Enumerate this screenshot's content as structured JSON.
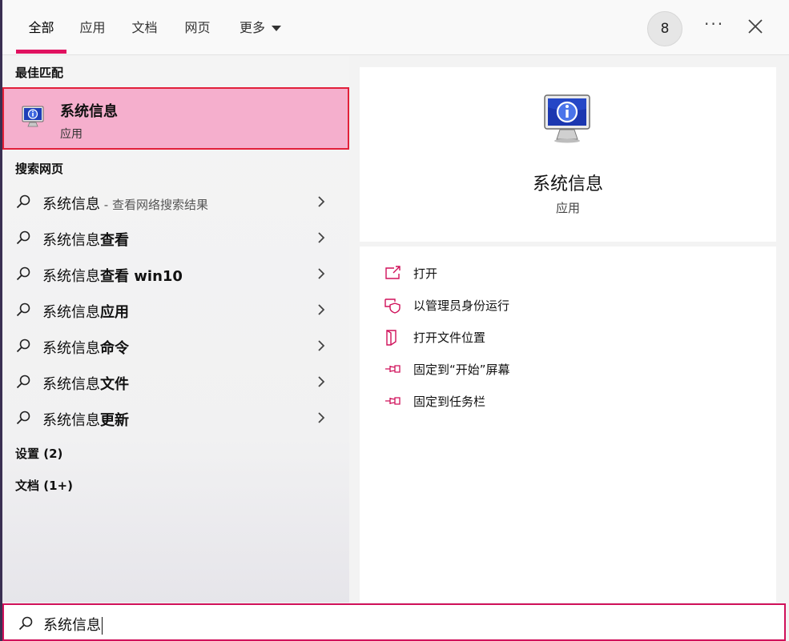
{
  "tabs": [
    {
      "label": "全部"
    },
    {
      "label": "应用"
    },
    {
      "label": "文档"
    },
    {
      "label": "网页"
    },
    {
      "label": "更多"
    }
  ],
  "badge": "8",
  "more_options": "···",
  "best_match": {
    "section": "最佳匹配",
    "name": "系统信息",
    "type": "应用"
  },
  "web_section": "搜索网页",
  "web_results": [
    {
      "prefix": "系统信息",
      "bold": "",
      "hint": " - 查看网络搜索结果"
    },
    {
      "prefix": "系统信息",
      "bold": "查看",
      "hint": ""
    },
    {
      "prefix": "系统信息",
      "bold": "查看 win10",
      "hint": ""
    },
    {
      "prefix": "系统信息",
      "bold": "应用",
      "hint": ""
    },
    {
      "prefix": "系统信息",
      "bold": "命令",
      "hint": ""
    },
    {
      "prefix": "系统信息",
      "bold": "文件",
      "hint": ""
    },
    {
      "prefix": "系统信息",
      "bold": "更新",
      "hint": ""
    }
  ],
  "settings_section": "设置 (2)",
  "docs_section": "文档 (1+)",
  "preview": {
    "name": "系统信息",
    "type": "应用"
  },
  "actions": [
    {
      "label": "打开",
      "icon": "open-icon"
    },
    {
      "label": "以管理员身份运行",
      "icon": "shield-icon"
    },
    {
      "label": "打开文件位置",
      "icon": "file-location-icon"
    },
    {
      "label": "固定到“开始”屏幕",
      "icon": "pin-icon"
    },
    {
      "label": "固定到任务栏",
      "icon": "pin-icon"
    }
  ],
  "search": {
    "value": "系统信息"
  },
  "colors": {
    "accent": "#e0115f",
    "highlight": "#f5afcd",
    "highlight_border": "#e2203a"
  }
}
